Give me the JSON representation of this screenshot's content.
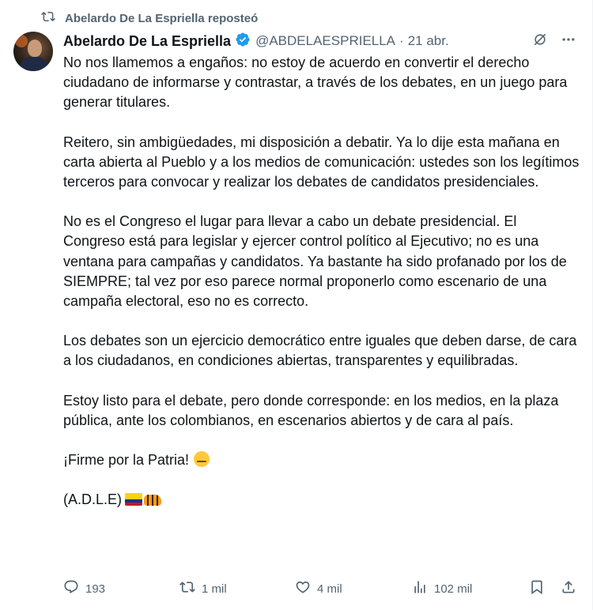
{
  "repost": {
    "text": "Abelardo De La Espriella reposteó"
  },
  "author": {
    "name": "Abelardo De La Espriella",
    "handle": "@ABDELAESPRIELLA",
    "separator": "·",
    "date": "21 abr."
  },
  "tweet": {
    "paragraphs": [
      "No nos llamemos a engaños: no estoy de acuerdo en convertir el derecho ciudadano de informarse y contrastar, a través de los debates, en un juego para generar titulares.",
      "Reitero, sin ambigüedades, mi disposición a debatir. Ya lo dije esta mañana en carta abierta al Pueblo y a los medios de comunicación: ustedes son los legítimos terceros para convocar y realizar los debates de candidatos presidenciales.",
      "No es el Congreso el lugar para llevar a cabo un debate presidencial. El Congreso está para legislar y ejercer control político al Ejecutivo; no es una ventana para campañas y candidatos. Ya bastante ha sido profanado por los de SIEMPRE; tal vez por eso parece normal proponerlo como escenario de una campaña electoral, eso no es correcto.",
      "Los debates son un ejercicio democrático entre iguales que deben darse, de cara a los ciudadanos, en condiciones abiertas, transparentes y equilibradas.",
      "Estoy listo para el debate, pero donde corresponde: en los medios, en la plaza pública, ante los colombianos, en escenarios abiertos y de cara al país."
    ],
    "closing": "¡Firme por la Patria!",
    "signature": "(A.D.L.E)"
  },
  "metrics": {
    "replies": "193",
    "reposts": "1 mil",
    "likes": "4 mil",
    "views": "102 mil"
  },
  "icons": {
    "repost": "repost-icon",
    "verified": "verified-badge-icon",
    "grok": "grok-icon",
    "more": "more-icon",
    "reply": "reply-icon",
    "like": "like-icon",
    "views": "views-icon",
    "bookmark": "bookmark-icon",
    "share": "share-icon",
    "emoji": [
      "saluting-face-emoji",
      "colombia-flag-emoji",
      "tiger-emoji"
    ]
  },
  "colors": {
    "secondary_text": "#536471",
    "primary_text": "#0f1419",
    "verified": "#1d9bf0"
  }
}
